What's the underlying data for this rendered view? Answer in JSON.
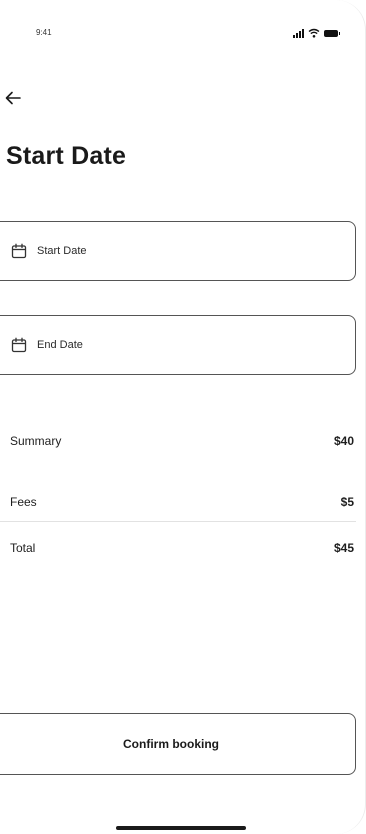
{
  "status_bar": {
    "time": "9:41"
  },
  "header": {
    "title": "Start Date"
  },
  "dates": {
    "start_label": "Start Date",
    "end_label": "End Date"
  },
  "summary": {
    "rows": [
      {
        "label": "Summary",
        "value": "$40"
      },
      {
        "label": "Fees",
        "value": "$5"
      },
      {
        "label": "Total",
        "value": "$45"
      }
    ]
  },
  "actions": {
    "confirm_label": "Confirm booking"
  },
  "icons": {
    "back": "back-arrow-icon",
    "calendar": "calendar-icon",
    "signal": "signal-icon",
    "wifi": "wifi-icon",
    "battery": "battery-icon"
  }
}
